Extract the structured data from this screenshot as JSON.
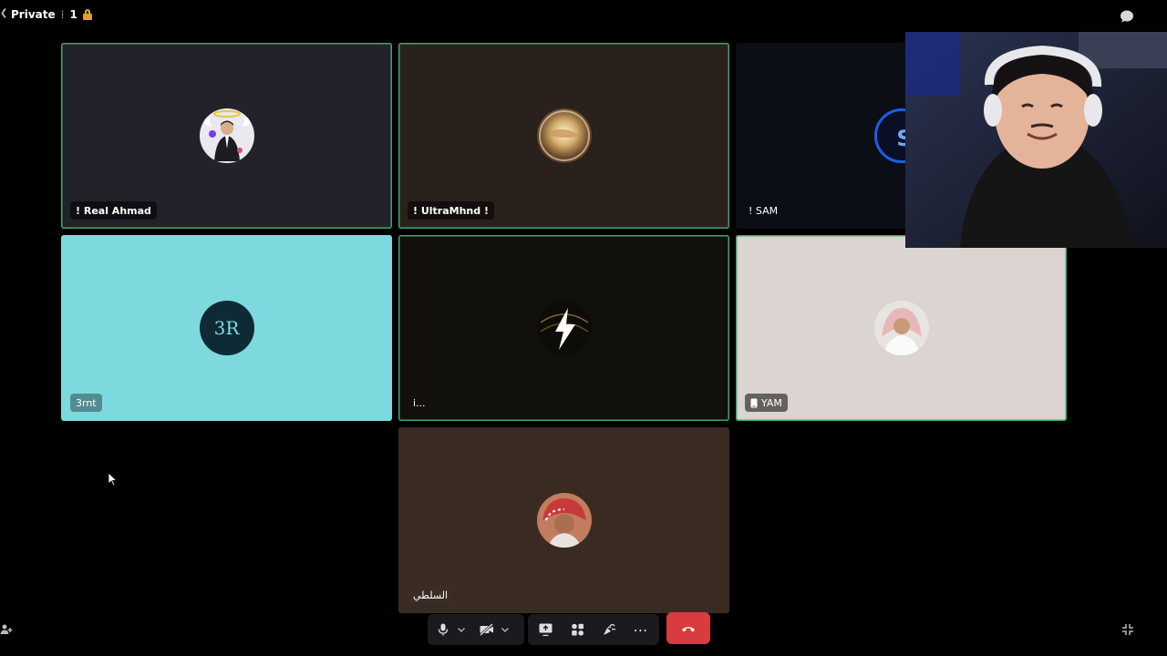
{
  "window": {
    "title": "Private",
    "title_suffix": "1"
  },
  "participants": [
    {
      "name": "! Real Ahmad",
      "bg": "#23222b",
      "speaking": true
    },
    {
      "name": "! UltraMhnd !",
      "bg": "#2a211d",
      "speaking": true
    },
    {
      "name": "! SAM",
      "bg": "#0c0e16",
      "speaking": false
    },
    {
      "name": "3rnt",
      "bg": "#7dd9de",
      "speaking": false
    },
    {
      "name": "i...",
      "bg": "#12100c",
      "speaking": true
    },
    {
      "name": "YAM",
      "bg": "#dcd4d0",
      "speaking": true,
      "device": "phone-icon"
    },
    {
      "name": "السلطي",
      "bg": "#3a2b22",
      "speaking": false
    }
  ],
  "avatar_text": {
    "p4": "3R"
  },
  "controls": {
    "mic": "microphone-icon",
    "camera": "camera-off-icon",
    "screen_share": "screen-share-icon",
    "activities": "activities-icon",
    "soundboard": "soundboard-icon",
    "more": "⋯",
    "hangup": "hang-up-icon"
  },
  "colors": {
    "speaking_border": "#3aa86b",
    "hangup": "#d83c3e",
    "toolbar_bg": "#1b1b1f"
  }
}
